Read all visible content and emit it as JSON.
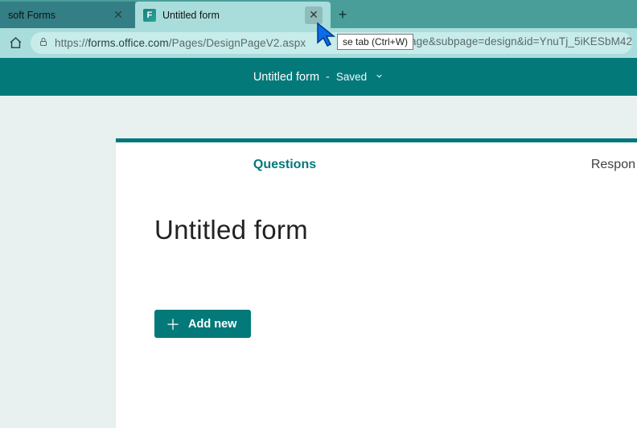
{
  "browser": {
    "tabs": [
      {
        "label": "soft Forms"
      },
      {
        "label": "Untitled form"
      }
    ],
    "tooltip": "se tab (Ctrl+W)",
    "url_prefix": "https://",
    "url_host": "forms.office.com",
    "url_path": "/Pages/DesignPageV2.aspx",
    "url_query_tail": "age&subpage=design&id=YnuTj_5iKESbM42"
  },
  "header": {
    "title": "Untitled form",
    "dash": "-",
    "status": "Saved"
  },
  "form": {
    "tabs": {
      "questions": "Questions",
      "responses": "Respon"
    },
    "title": "Untitled form",
    "add_new": "Add new"
  }
}
